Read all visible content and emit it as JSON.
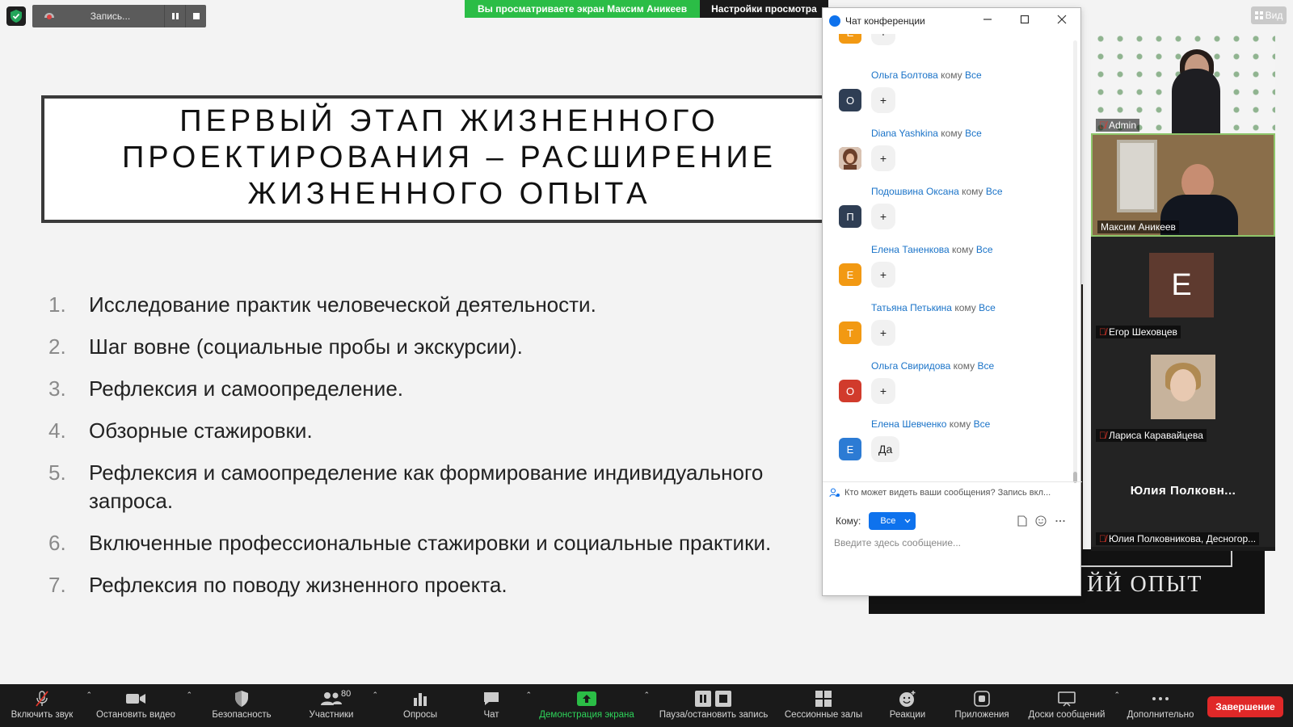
{
  "topbar": {
    "recording_label": "Запись...",
    "pause_icon": "pause-icon",
    "stop_icon": "stop-icon",
    "viewing_banner": "Вы просматриваете экран Максим Аникеев",
    "view_settings": "Настройки просмотра",
    "view_button": "Вид"
  },
  "slide": {
    "title": "Первый этап жизненного проектирования – расширение жизненного опыта",
    "items": [
      {
        "num": "1.",
        "text": "Исследование практик человеческой деятельности."
      },
      {
        "num": "2.",
        "text": "Шаг вовне (социальные пробы и экскурсии)."
      },
      {
        "num": "3.",
        "text": "Рефлексия и самоопределение."
      },
      {
        "num": "4.",
        "text": "Обзорные стажировки."
      },
      {
        "num": "5.",
        "text": "Рефлексия и самоопределение как формирование индивидуального запроса."
      },
      {
        "num": "6.",
        "text": "Включенные профессиональные стажировки и социальные практики."
      },
      {
        "num": "7.",
        "text": "Рефлексия по поводу жизненного проекта."
      }
    ],
    "background_fragment_text": "ЙЙ ОПЫТ"
  },
  "chat": {
    "window_title": "Чат конференции",
    "to_word": "кому",
    "partial_top": {
      "avatar": "Е",
      "avatar_color": "#f29913",
      "text": "+"
    },
    "messages": [
      {
        "sender": "Ольга Болтова",
        "recipient": "Все",
        "avatar": "О",
        "avatar_color": "#2f3e54",
        "text": "+"
      },
      {
        "sender": "Diana Yashkina",
        "recipient": "Все",
        "avatar": "",
        "avatar_color": "#9c6d57",
        "text": "+"
      },
      {
        "sender": "Подошвина Оксана",
        "recipient": "Все",
        "avatar": "П",
        "avatar_color": "#2f3e54",
        "text": "+"
      },
      {
        "sender": "Елена Таненкова",
        "recipient": "Все",
        "avatar": "Е",
        "avatar_color": "#f29913",
        "text": "+"
      },
      {
        "sender": "Татьяна Петькина",
        "recipient": "Все",
        "avatar": "Т",
        "avatar_color": "#f29913",
        "text": "+"
      },
      {
        "sender": "Ольга Свиридова",
        "recipient": "Все",
        "avatar": "О",
        "avatar_color": "#d13b2c",
        "text": "+"
      },
      {
        "sender": "Елена Шевченко",
        "recipient": "Все",
        "avatar": "Е",
        "avatar_color": "#2c7bd4",
        "text": "Да"
      }
    ],
    "privacy_text": "Кто может видеть ваши сообщения? Запись вкл...",
    "to_label": "Кому:",
    "to_value": "Все",
    "input_placeholder": "Введите здесь сообщение..."
  },
  "participants": [
    {
      "name": "Admin",
      "muted": true
    },
    {
      "name": "Максим Аникеев",
      "muted": false
    },
    {
      "name": "Егор Шеховцев",
      "muted": true,
      "initial": "E"
    },
    {
      "name": "Лариса Каравайцева",
      "muted": true
    },
    {
      "name": "Юлия Полковникова, Десногор...",
      "muted": true,
      "display": "Юлия  Полковн..."
    }
  ],
  "toolbar": {
    "items": [
      {
        "label": "Включить звук",
        "icon": "mic-muted-icon"
      },
      {
        "label": "Остановить видео",
        "icon": "video-camera-icon"
      },
      {
        "label": "Безопасность",
        "icon": "shield-icon"
      },
      {
        "label": "Участники",
        "icon": "participants-icon",
        "count": "80"
      },
      {
        "label": "Опросы",
        "icon": "polls-icon"
      },
      {
        "label": "Чат",
        "icon": "chat-icon"
      },
      {
        "label": "Демонстрация экрана",
        "icon": "share-screen-icon"
      },
      {
        "label": "Пауза/остановить запись",
        "icon": "pause-stop-record-icon"
      },
      {
        "label": "Сессионные залы",
        "icon": "breakout-rooms-icon"
      },
      {
        "label": "Реакции",
        "icon": "reactions-icon"
      },
      {
        "label": "Приложения",
        "icon": "apps-icon"
      },
      {
        "label": "Доски сообщений",
        "icon": "whiteboard-icon"
      },
      {
        "label": "Дополнительно",
        "icon": "more-icon"
      }
    ],
    "end_button": "Завершение"
  },
  "colors": {
    "accent": "#0e72ed",
    "share_green": "#2bbd46",
    "end_red": "#e02828",
    "mute_red": "#e0362a"
  }
}
